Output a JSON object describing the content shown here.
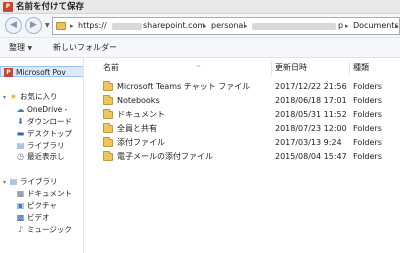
{
  "window": {
    "app_badge": "P",
    "title": "名前を付けて保存"
  },
  "address": {
    "prefix": "https://",
    "host_suffix": "sharepoint.com",
    "segment_personal": "personal",
    "segment_tail": "p",
    "segment_documents": "Documents",
    "separator": "▸"
  },
  "toolbar": {
    "organize": "整理",
    "organize_dropdown": "▼",
    "new_folder": "新しいフォルダー"
  },
  "sidebar": {
    "items": [
      {
        "label": "Microsoft Pov",
        "icon": "powerpoint-icon"
      },
      {
        "label": "お気に入り",
        "icon": "star-icon"
      },
      {
        "label": "OneDrive -",
        "icon": "cloud-icon"
      },
      {
        "label": "ダウンロード",
        "icon": "download-folder-icon"
      },
      {
        "label": "デスクトップ",
        "icon": "desktop-icon"
      },
      {
        "label": "ライブラリ",
        "icon": "library-icon"
      },
      {
        "label": "最近表示し",
        "icon": "recent-icon"
      },
      {
        "label": "ライブラリ",
        "icon": "library-icon"
      },
      {
        "label": "ドキュメント",
        "icon": "documents-icon"
      },
      {
        "label": "ピクチャ",
        "icon": "pictures-icon"
      },
      {
        "label": "ビデオ",
        "icon": "video-icon"
      },
      {
        "label": "ミュージック",
        "icon": "music-icon"
      }
    ]
  },
  "columns": {
    "name": "名前",
    "modified": "更新日時",
    "type": "種類"
  },
  "files": [
    {
      "name": "Microsoft Teams チャット ファイル",
      "modified": "2017/12/22 21:56",
      "type": "Folders"
    },
    {
      "name": "Notebooks",
      "modified": "2018/06/18 17:01",
      "type": "Folders"
    },
    {
      "name": "ドキュメント",
      "modified": "2018/05/31 11:52",
      "type": "Folders"
    },
    {
      "name": "全員と共有",
      "modified": "2018/07/23 12:00",
      "type": "Folders"
    },
    {
      "name": "添付ファイル",
      "modified": "2017/03/13 9:24",
      "type": "Folders"
    },
    {
      "name": "電子メールの添付ファイル",
      "modified": "2015/08/04 15:47",
      "type": "Folders"
    }
  ]
}
